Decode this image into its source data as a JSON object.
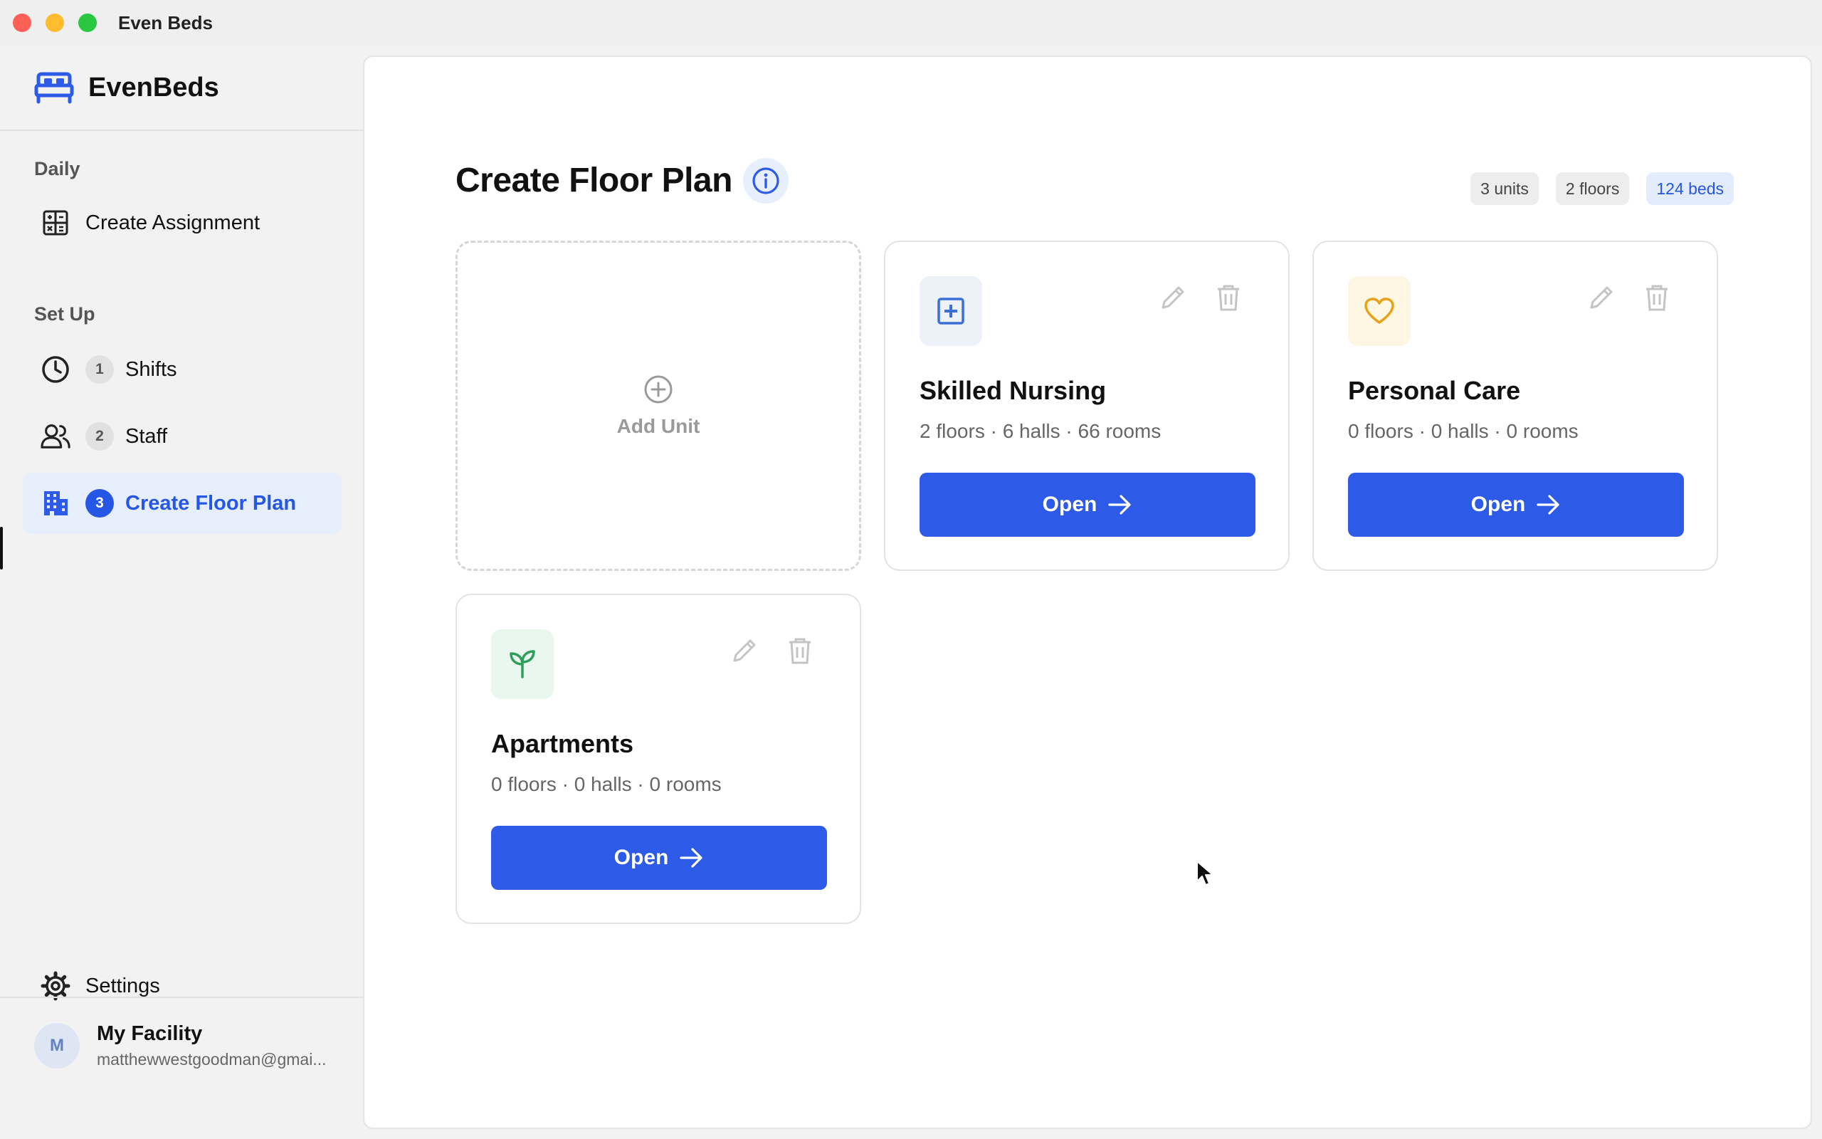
{
  "window": {
    "title": "Even Beds"
  },
  "brand": {
    "name": "EvenBeds",
    "icon": "bed-icon"
  },
  "sidebar": {
    "sections": [
      {
        "title": "Daily"
      },
      {
        "title": "Set Up"
      }
    ],
    "daily_items": [
      {
        "label": "Create Assignment",
        "icon": "calculator-icon"
      }
    ],
    "setup_items": [
      {
        "label": "Shifts",
        "step": "1",
        "icon": "clock-icon"
      },
      {
        "label": "Staff",
        "step": "2",
        "icon": "users-icon"
      },
      {
        "label": "Create Floor Plan",
        "step": "3",
        "icon": "building-icon",
        "active": true
      }
    ],
    "settings": {
      "label": "Settings",
      "icon": "gear-icon"
    },
    "account": {
      "avatar": "M",
      "name": "My Facility",
      "email": "matthewwestgoodman@gmai..."
    }
  },
  "main": {
    "title": "Create Floor Plan",
    "stats": {
      "units": "3 units",
      "floors": "2 floors",
      "beds": "124 beds"
    },
    "add_unit_label": "Add Unit",
    "units": [
      {
        "name": "Skilled Nursing",
        "meta": "2 floors · 6 halls · 66 rooms",
        "open_label": "Open",
        "icon": "medical-plus-icon",
        "icon_color": "#3b6fd6",
        "icon_bg": "#edf2f9"
      },
      {
        "name": "Personal Care",
        "meta": "0 floors · 0 halls · 0 rooms",
        "open_label": "Open",
        "icon": "heart-icon",
        "icon_color": "#e6a21a",
        "icon_bg": "#fdf6e3"
      },
      {
        "name": "Apartments",
        "meta": "0 floors · 0 halls · 0 rooms",
        "open_label": "Open",
        "icon": "sprout-icon",
        "icon_color": "#2e9e5b",
        "icon_bg": "#e9f7ee"
      }
    ]
  },
  "colors": {
    "accent": "#2d5be8",
    "active_nav_bg": "#e6eefc"
  }
}
